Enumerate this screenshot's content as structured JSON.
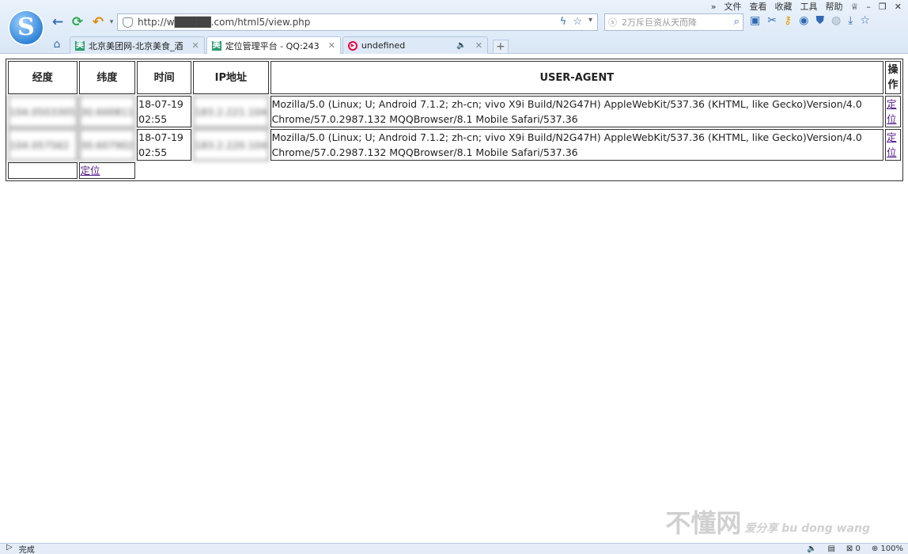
{
  "browser": {
    "menu": [
      "»",
      "文件",
      "查看",
      "收藏",
      "工具",
      "帮助"
    ],
    "url": "http://w█████.com/html5/view.php",
    "search_placeholder": "2万斥巨资从天而降",
    "tabs": [
      {
        "label": "北京美团网-北京美食_酒",
        "fav": "美",
        "active": false
      },
      {
        "label": "定位管理平台 - QQ:243",
        "fav": "美",
        "active": true
      },
      {
        "label": "undefined",
        "fav": "▶",
        "active": false
      }
    ],
    "new_tab": "+"
  },
  "table": {
    "headers": [
      "经度",
      "纬度",
      "时间",
      "IP地址",
      "USER-AGENT",
      "操作"
    ],
    "rows": [
      {
        "lon": "104.0503305",
        "lat": "30.600811",
        "time": "18-07-19 02:55",
        "ip": "183.2.221.104",
        "ua": "Mozilla/5.0 (Linux; U; Android 7.1.2; zh-cn; vivo X9i Build/N2G47H) AppleWebKit/537.36 (KHTML, like Gecko)Version/4.0 Chrome/57.0.2987.132 MQQBrowser/8.1 Mobile Safari/537.36",
        "action": "定位"
      },
      {
        "lon": "104.057562",
        "lat": "30.607902",
        "time": "18-07-19 02:55",
        "ip": "183.2.220.104",
        "ua": "Mozilla/5.0 (Linux; U; Android 7.1.2; zh-cn; vivo X9i Build/N2G47H) AppleWebKit/537.36 (KHTML, like Gecko)Version/4.0 Chrome/57.0.2987.132 MQQBrowser/8.1 Mobile Safari/537.36",
        "action": "定位"
      }
    ],
    "footer_link": "定位"
  },
  "watermark": {
    "text": "不懂网",
    "sub": "爱分享 bu dong wang"
  },
  "status": {
    "left": "完成",
    "counter": "0",
    "zoom": "100%"
  }
}
